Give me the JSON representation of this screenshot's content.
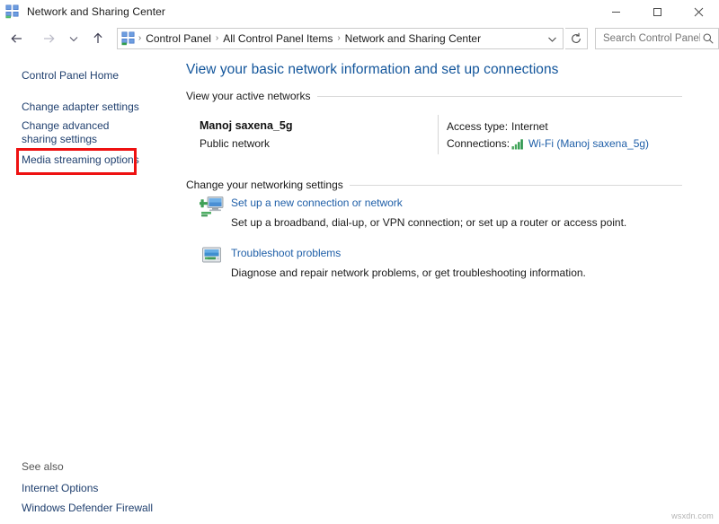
{
  "window": {
    "title": "Network and Sharing Center",
    "icon": "network-sharing-center-icon",
    "minimize_label": "Minimize",
    "maximize_label": "Maximize",
    "close_label": "Close"
  },
  "navbar": {
    "back_label": "Back",
    "forward_label": "Forward",
    "recent_label": "Recent locations",
    "up_label": "Up one level",
    "refresh_label": "Refresh",
    "breadcrumbs": [
      "Control Panel",
      "All Control Panel Items",
      "Network and Sharing Center"
    ],
    "separator": "›",
    "dropdown_label": "Previous locations"
  },
  "search": {
    "placeholder": "Search Control Panel",
    "value": "",
    "icon": "search-icon"
  },
  "sidebar": {
    "items": [
      {
        "label": "Control Panel Home",
        "highlighted": false
      },
      {
        "label": "Change adapter settings",
        "highlighted": true
      },
      {
        "label": "Change advanced sharing settings",
        "highlighted": false
      },
      {
        "label": "Media streaming options",
        "highlighted": false
      }
    ],
    "see_also_title": "See also",
    "see_also_items": [
      {
        "label": "Internet Options"
      },
      {
        "label": "Windows Defender Firewall"
      }
    ],
    "highlight_color": "#ee1111"
  },
  "main": {
    "heading": "View your basic network information and set up connections",
    "active_networks_section": "View your active networks",
    "network": {
      "name": "Manoj saxena_5g",
      "type": "Public network",
      "access_type_label": "Access type:",
      "access_type_value": "Internet",
      "connections_label": "Connections:",
      "connection_value": "Wi-Fi (Manoj saxena_5g)",
      "connection_icon": "wifi-signal-icon"
    },
    "change_settings_section": "Change your networking settings",
    "tasks": [
      {
        "icon": "new-connection-icon",
        "link": "Set up a new connection or network",
        "description": "Set up a broadband, dial-up, or VPN connection; or set up a router or access point."
      },
      {
        "icon": "troubleshoot-icon",
        "link": "Troubleshoot problems",
        "description": "Diagnose and repair network problems, or get troubleshooting information."
      }
    ]
  },
  "watermark": "wsxdn.com",
  "colors": {
    "heading": "#12559b",
    "link": "#1f5fa8",
    "sidebar_link": "#1f3f6e",
    "highlight": "#ee1111"
  }
}
